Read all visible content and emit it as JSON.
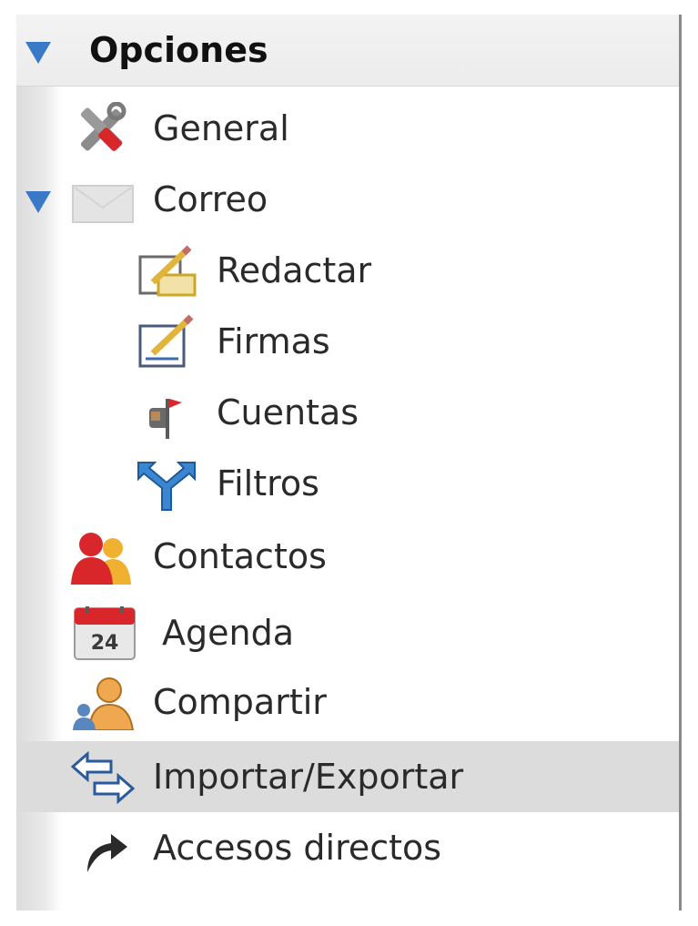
{
  "tree": {
    "header": "Opciones",
    "items": [
      {
        "label": "General",
        "icon": "tools-icon"
      },
      {
        "label": "Correo",
        "icon": "envelope-icon"
      },
      {
        "label": "Redactar",
        "icon": "compose-icon"
      },
      {
        "label": "Firmas",
        "icon": "signature-icon"
      },
      {
        "label": "Cuentas",
        "icon": "mailbox-icon"
      },
      {
        "label": "Filtros",
        "icon": "filter-icon"
      },
      {
        "label": "Contactos",
        "icon": "contacts-icon"
      },
      {
        "label": "Agenda",
        "icon": "calendar-icon",
        "day": "24"
      },
      {
        "label": "Compartir",
        "icon": "share-icon"
      },
      {
        "label": "Importar/Exportar",
        "icon": "import-export-icon"
      },
      {
        "label": "Accesos directos",
        "icon": "shortcut-icon"
      }
    ],
    "selected_item": "Importar/Exportar"
  },
  "colors": {
    "arrow": "#3a78c8",
    "selection": "#dcdcdc"
  }
}
